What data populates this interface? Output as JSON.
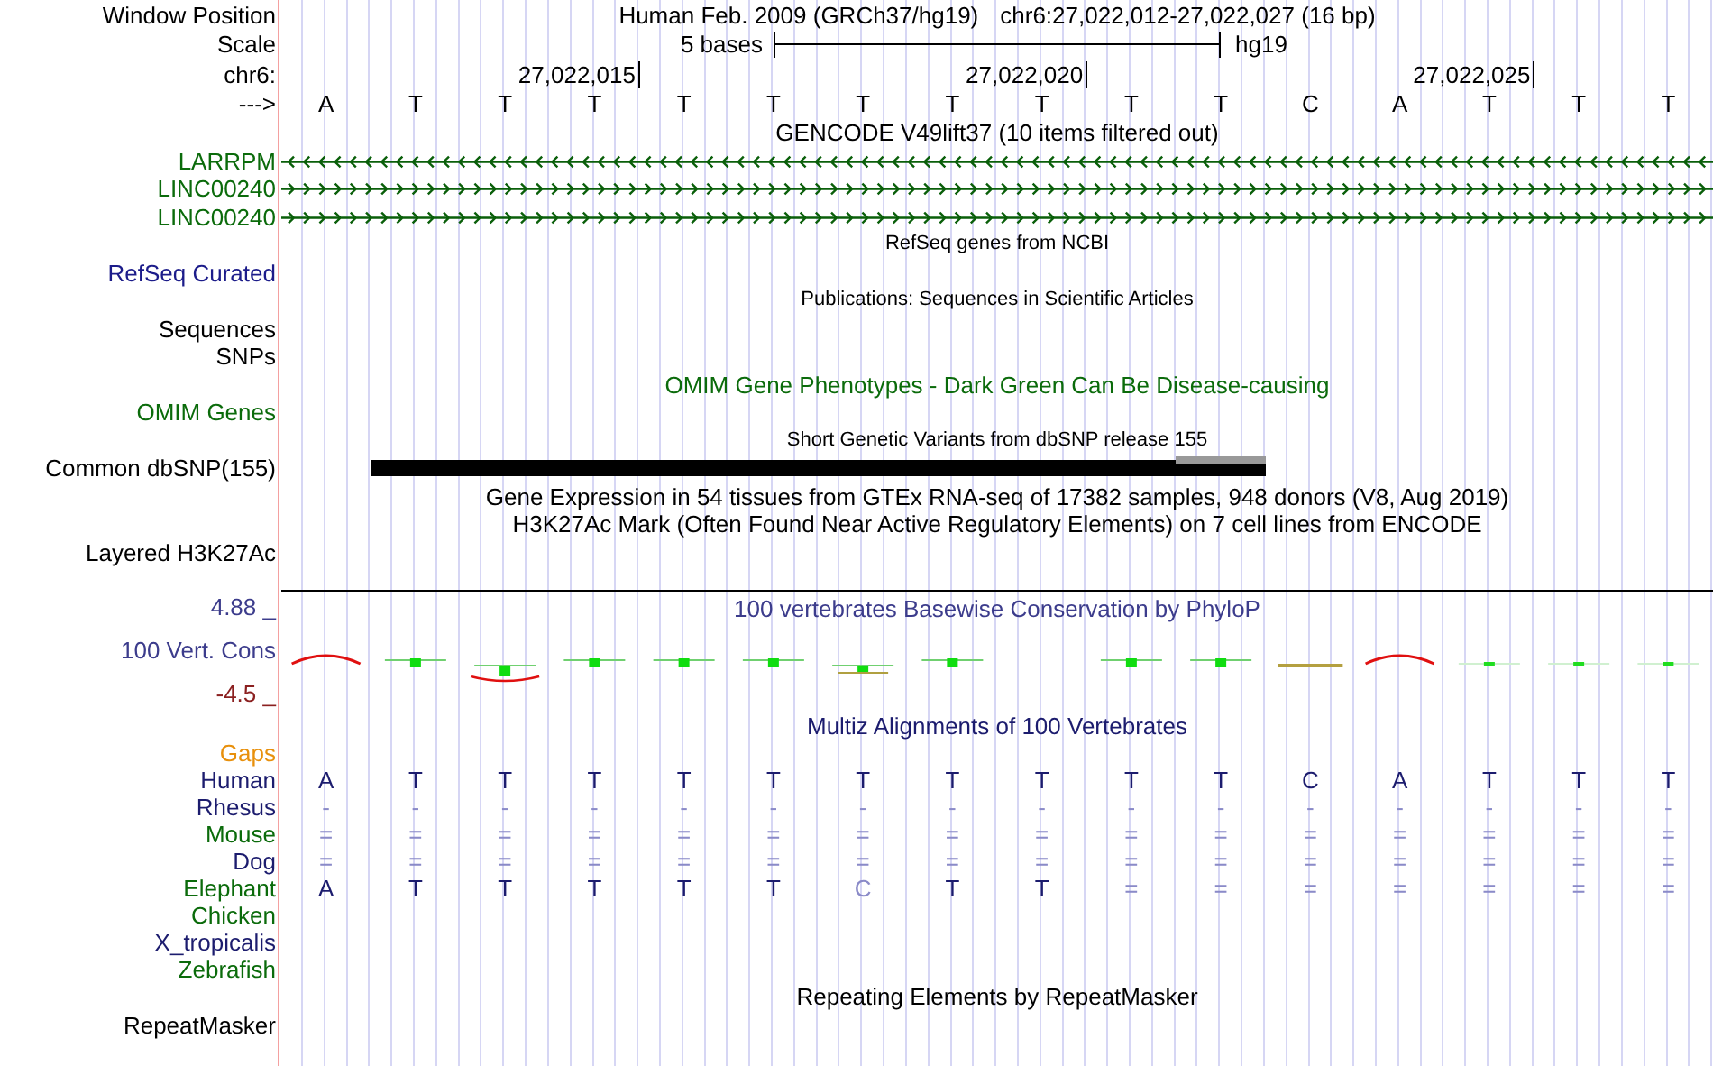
{
  "header": {
    "label": "Window Position",
    "assembly": "Human Feb. 2009 (GRCh37/hg19)",
    "range": "chr6:27,022,012-27,022,027 (16 bp)"
  },
  "scale": {
    "label": "Scale",
    "bar_label": "5 bases",
    "assembly": "hg19"
  },
  "coordinates": {
    "label": "chr6:",
    "ticks": [
      "27,022,015",
      "27,022,020",
      "27,022,025"
    ]
  },
  "sequence": {
    "label": "--->",
    "bases": [
      "A",
      "T",
      "T",
      "T",
      "T",
      "T",
      "T",
      "T",
      "T",
      "T",
      "T",
      "C",
      "A",
      "T",
      "T",
      "T"
    ]
  },
  "tracks": [
    {
      "kind": "genes",
      "title": "GENCODE V49lift37 (10 items filtered out)",
      "genes": [
        {
          "name": "LARRPM",
          "kind": "reverse"
        },
        {
          "name": "LINC00240",
          "kind": "forward"
        },
        {
          "name": "LINC00240",
          "kind": "forward"
        }
      ]
    },
    {
      "kind": "minor",
      "title": "RefSeq genes from NCBI",
      "label": "RefSeq Curated",
      "color": "#1c1c8a"
    },
    {
      "kind": "minor",
      "title": "Publications: Sequences in Scientific Articles",
      "label": "Sequences",
      "color": "#000000"
    },
    {
      "kind": "label",
      "label": "SNPs",
      "color": "#000000"
    },
    {
      "kind": "major",
      "title": "OMIM Gene Phenotypes - Dark Green Can Be Disease-causing",
      "label": "OMIM Genes",
      "color": "#0b6b0b"
    },
    {
      "kind": "snp",
      "title": "Short Genetic Variants from dbSNP release 155",
      "label": "Common dbSNP(155)",
      "color": "#000000"
    },
    {
      "kind": "major",
      "title": "Gene Expression in 54 tissues from GTEx RNA-seq of 17382 samples, 948 donors (V8, Aug 2019)",
      "color": "#000000"
    },
    {
      "kind": "major",
      "title": "H3K27Ac Mark (Often Found Near Active Regulatory Elements) on 7 cell lines from ENCODE",
      "label": "Layered H3K27Ac",
      "color": "#000000"
    },
    {
      "kind": "conservation",
      "title": "100 vertebrates Basewise Conservation by PhyloP",
      "label": "100 Vert. Cons",
      "max": "4.88 _",
      "min": "-4.5 _",
      "color": "#3c3c8c"
    },
    {
      "kind": "alignment",
      "title": "Multiz Alignments of 100 Vertebrates",
      "color": "#1c1c6e",
      "species": [
        {
          "name": "Gaps",
          "color": "#e8900c"
        },
        {
          "name": "Human",
          "color": "#1c1c6e",
          "bases": [
            "A",
            "T",
            "T",
            "T",
            "T",
            "T",
            "T",
            "T",
            "T",
            "T",
            "T",
            "C",
            "A",
            "T",
            "T",
            "T"
          ]
        },
        {
          "name": "Rhesus",
          "color": "#1c1c6e",
          "bases": [
            "-",
            "-",
            "-",
            "-",
            "-",
            "-",
            "-",
            "-",
            "-",
            "-",
            "-",
            "-",
            "-",
            "-",
            "-",
            "-"
          ]
        },
        {
          "name": "Mouse",
          "color": "#0b6b0b",
          "bases": [
            "=",
            "=",
            "=",
            "=",
            "=",
            "=",
            "=",
            "=",
            "=",
            "=",
            "=",
            "=",
            "=",
            "=",
            "=",
            "="
          ]
        },
        {
          "name": "Dog",
          "color": "#1c1c6e",
          "bases": [
            "=",
            "=",
            "=",
            "=",
            "=",
            "=",
            "=",
            "=",
            "=",
            "=",
            "=",
            "=",
            "=",
            "=",
            "=",
            "="
          ]
        },
        {
          "name": "Elephant",
          "color": "#0b6b0b",
          "bases": [
            "A",
            "T",
            "T",
            "T",
            "T",
            "T",
            "C",
            "T",
            "T",
            "=",
            "=",
            "=",
            "=",
            "=",
            "=",
            "="
          ]
        },
        {
          "name": "Chicken",
          "color": "#0b6b0b"
        },
        {
          "name": "X_tropicalis",
          "color": "#1c1c6e"
        },
        {
          "name": "Zebrafish",
          "color": "#0b6b0b"
        }
      ]
    },
    {
      "kind": "major",
      "title": "Repeating Elements by RepeatMasker",
      "label": "RepeatMasker",
      "color": "#000000"
    }
  ]
}
